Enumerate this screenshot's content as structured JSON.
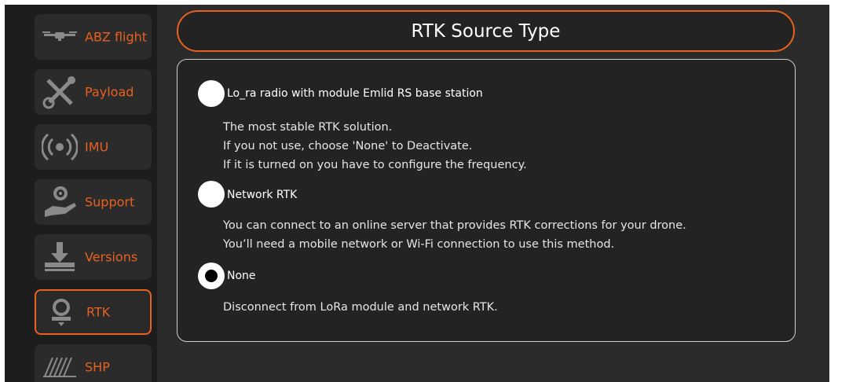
{
  "sidebar": {
    "items": [
      {
        "label": "ABZ flight",
        "icon": "drone-icon"
      },
      {
        "label": "Payload",
        "icon": "tools-icon"
      },
      {
        "label": "IMU",
        "icon": "signal-icon"
      },
      {
        "label": "Support",
        "icon": "support-hand-icon"
      },
      {
        "label": "Versions",
        "icon": "download-icon"
      },
      {
        "label": "RTK",
        "icon": "rtk-pin-icon",
        "active": true
      },
      {
        "label": "SHP",
        "icon": "field-icon"
      }
    ]
  },
  "header": {
    "title": "RTK Source Type"
  },
  "options": [
    {
      "label": "Lo_ra radio with module Emlid RS base station",
      "selected": false,
      "description": [
        "The most stable RTK solution.",
        "If you not use, choose 'None' to Deactivate.",
        "If it is turned on you have to configure the frequency."
      ]
    },
    {
      "label": "Network RTK",
      "selected": false,
      "description": [
        "You can connect to an online server that provides RTK corrections for your drone.",
        "You’ll need a mobile network or Wi-Fi connection to use this method."
      ]
    },
    {
      "label": "None",
      "selected": true,
      "description": [
        "Disconnect from LoRa module and network RTK."
      ]
    }
  ],
  "colors": {
    "accent": "#e8611f",
    "background": "#2b2b2b",
    "sidebar": "#1d1d1d",
    "panel": "#232323"
  }
}
